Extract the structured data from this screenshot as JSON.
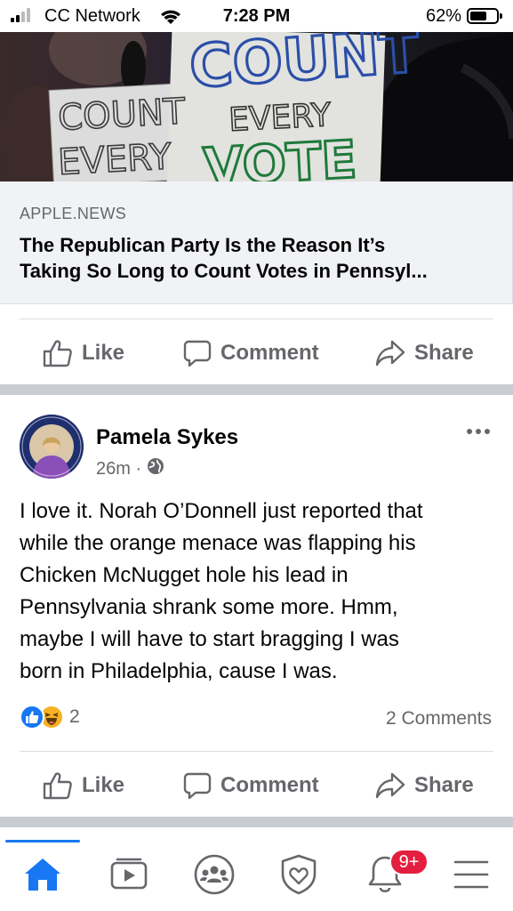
{
  "status_bar": {
    "carrier": "CC Network",
    "time": "7:28 PM",
    "battery": "62%"
  },
  "link_preview": {
    "domain": "APPLE.NEWS",
    "title_line1": "The Republican Party Is the Reason It’s",
    "title_line2": "Taking So Long to Count Votes in Pennsyl...",
    "image_signs": {
      "sign_left_line1": "COUNT",
      "sign_left_line2": "EVERY",
      "sign_right_line1": "COUNT",
      "sign_right_line2": "EVERY",
      "sign_right_line3": "VOTE"
    }
  },
  "actions": {
    "like": "Like",
    "comment": "Comment",
    "share": "Share"
  },
  "post": {
    "author": "Pamela Sykes",
    "time": "26m ·",
    "audience_icon": "globe-icon",
    "text_lines": [
      "I love it. Norah O’Donnell just reported that",
      "while the orange menace was flapping his",
      "Chicken McNugget hole his lead in",
      "Pennsylvania shrank some more.  Hmm,",
      "maybe I will have to start bragging I was",
      "born in Philadelphia, cause I was."
    ],
    "reaction_icons": [
      "like-reaction-icon",
      "haha-reaction-icon"
    ],
    "reaction_count": "2",
    "comments_count": "2 Comments"
  },
  "tab_bar": {
    "tabs": [
      "home-icon",
      "watch-icon",
      "groups-icon",
      "dating-icon",
      "notifications-icon",
      "menu-icon"
    ],
    "notifications_badge": "9+"
  },
  "colors": {
    "accent": "#1877f2",
    "badge": "#e41e3f",
    "secondary_text": "#65676b",
    "separator": "#c9ccd1"
  }
}
